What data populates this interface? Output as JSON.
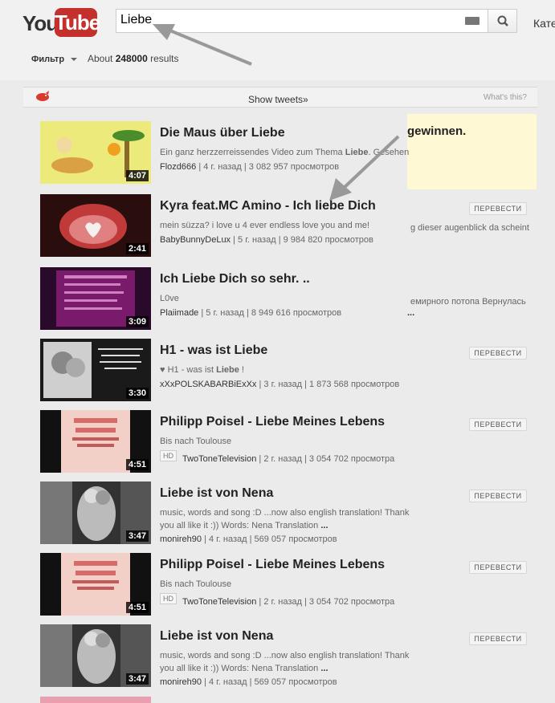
{
  "header": {
    "logo_you": "You",
    "logo_tube": "Tube",
    "search_value": "Liebe",
    "categories_link": "Кате",
    "filter_label": "Фильтр",
    "results_prefix": "About",
    "results_count": "248000",
    "results_suffix": "results"
  },
  "tweets_bar": {
    "show_tweets": "Show tweets",
    "whats_this": "What's this?"
  },
  "ad": {
    "text": "gewinnen."
  },
  "translate_label": "ПЕРЕВЕСТИ",
  "results": [
    {
      "title": "Die Maus über Liebe",
      "desc_pre": "Ein ganz herzzerreissendes Video zum Thema ",
      "desc_bold": "Liebe",
      "desc_post": ". Gesehen",
      "author": "Flozd666",
      "meta": " | 4 г. назад | 3 082 957 просмотров",
      "duration": "4:07"
    },
    {
      "title": "Kyra feat.MC Amino - Ich liebe Dich",
      "desc": "mein süzza? i love u 4 ever endless love you and me!",
      "author": "BabyBunnyDeLux",
      "meta": " | 5 г. назад | 9 984 820 просмотров",
      "duration": "2:41",
      "right_snip": "g dieser augenblick da scheint"
    },
    {
      "title": "Ich Liebe Dich so sehr. ..",
      "desc": "L0ve",
      "author": "Plaiimade",
      "meta": " | 5 г. назад | 8 949 616 просмотров",
      "duration": "3:09",
      "right_snip": "емирного потопа Вернулась",
      "right_snip2": "..."
    },
    {
      "title": "H1 - was ist Liebe",
      "desc_pre": "♥ H1 - was ist ",
      "desc_bold": "Liebe",
      "desc_post": " !",
      "author": "xXxPOLSKABARBiExXx",
      "meta": " | 3 г. назад | 1 873 568 просмотров",
      "duration": "3:30"
    },
    {
      "title": "Philipp Poisel - Liebe Meines Lebens",
      "desc": "Bis nach Toulouse",
      "hd": "HD",
      "author": "TwoToneTelevision",
      "meta": " | 2 г. назад | 3 054 702 просмотра",
      "duration": "4:51"
    },
    {
      "title": "Liebe ist von Nena",
      "desc": "music, words and song :D ...now also english translation! Thank you all like it :)) Words: Nena Translation",
      "desc_more": "...",
      "author": "monireh90",
      "meta": " | 4 г. назад | 569 057 просмотров",
      "duration": "3:47"
    },
    {
      "title": "Philipp Poisel - Liebe Meines Lebens",
      "desc": "Bis nach Toulouse",
      "hd": "HD",
      "author": "TwoToneTelevision",
      "meta": " | 2 г. назад | 3 054 702 просмотра",
      "duration": "4:51"
    },
    {
      "title": "Liebe ist von Nena",
      "desc": "music, words and song :D ...now also english translation! Thank you all like it :)) Words: Nena Translation",
      "desc_more": "...",
      "author": "monireh90",
      "meta": " | 4 г. назад | 569 057 просмотров",
      "duration": "3:47"
    }
  ]
}
